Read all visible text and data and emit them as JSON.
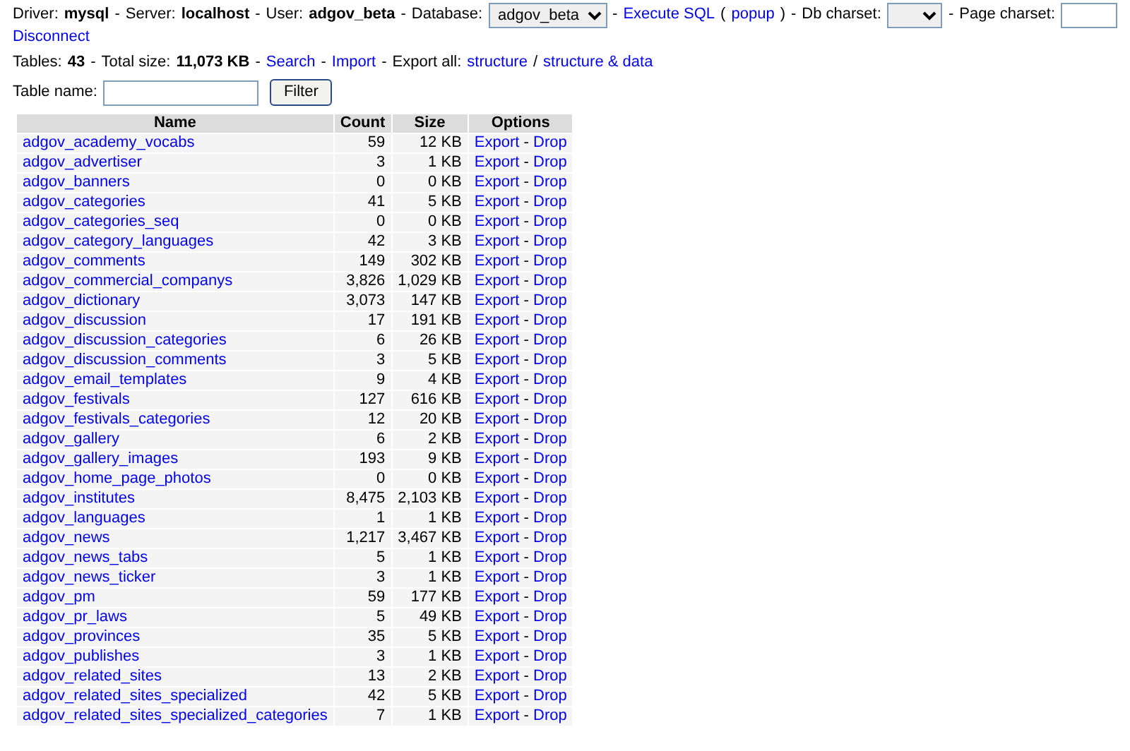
{
  "header": {
    "lines": [
      [
        {
          "kind": "text",
          "text": "Driver:"
        },
        {
          "kind": "bold",
          "text": "mysql"
        },
        {
          "kind": "sep",
          "text": "-"
        },
        {
          "kind": "text",
          "text": "Server:"
        },
        {
          "kind": "bold",
          "text": "localhost"
        },
        {
          "kind": "sep",
          "text": "-"
        },
        {
          "kind": "text",
          "text": "User:"
        },
        {
          "kind": "bold",
          "text": "adgov_beta"
        },
        {
          "kind": "sep",
          "text": "-"
        },
        {
          "kind": "text",
          "text": "Database:"
        },
        {
          "kind": "select",
          "text": "adgov_beta"
        },
        {
          "kind": "sep",
          "text": "-"
        },
        {
          "kind": "link",
          "text": "Execute SQL"
        },
        {
          "kind": "text",
          "text": "("
        },
        {
          "kind": "link",
          "text": "popup"
        },
        {
          "kind": "text",
          "text": ")"
        },
        {
          "kind": "sep",
          "text": "-"
        },
        {
          "kind": "text",
          "text": "Db charset:"
        },
        {
          "kind": "select"
        },
        {
          "kind": "sep",
          "text": "-"
        },
        {
          "kind": "text",
          "text": "Page charset:"
        },
        {
          "kind": "input"
        }
      ],
      [
        {
          "kind": "link",
          "text": "Disconnect"
        }
      ]
    ]
  },
  "stats": [
    {
      "kind": "text",
      "text": "Tables:"
    },
    {
      "kind": "bold",
      "text": "43"
    },
    {
      "kind": "sep",
      "text": "-"
    },
    {
      "kind": "text",
      "text": "Total size:"
    },
    {
      "kind": "bold",
      "text": "11,073 KB"
    },
    {
      "kind": "sep",
      "text": "-"
    },
    {
      "kind": "link",
      "text": "Search"
    },
    {
      "kind": "sep",
      "text": "-"
    },
    {
      "kind": "link",
      "text": "Import"
    },
    {
      "kind": "sep",
      "text": "-"
    },
    {
      "kind": "text",
      "text": "Export all:"
    },
    {
      "kind": "link",
      "text": "structure"
    },
    {
      "kind": "text",
      "text": "/"
    },
    {
      "kind": "link",
      "text": "structure & data"
    }
  ],
  "filter": {
    "label": "Table name:",
    "button": "Filter"
  },
  "table": {
    "columns": [
      "Name",
      "Count",
      "Size",
      "Options"
    ],
    "rows": [
      {
        "name": "adgov_academy_vocabs",
        "count": "59",
        "size": "12 KB",
        "export": "Export",
        "separator": "-",
        "drop": "Drop"
      },
      {
        "name": "adgov_advertiser",
        "count": "3",
        "size": "1 KB",
        "export": "Export",
        "separator": "-",
        "drop": "Drop"
      },
      {
        "name": "adgov_banners",
        "count": "0",
        "size": "0 KB",
        "export": "Export",
        "separator": "-",
        "drop": "Drop"
      },
      {
        "name": "adgov_categories",
        "count": "41",
        "size": "5 KB",
        "export": "Export",
        "separator": "-",
        "drop": "Drop"
      },
      {
        "name": "adgov_categories_seq",
        "count": "0",
        "size": "0 KB",
        "export": "Export",
        "separator": "-",
        "drop": "Drop"
      },
      {
        "name": "adgov_category_languages",
        "count": "42",
        "size": "3 KB",
        "export": "Export",
        "separator": "-",
        "drop": "Drop"
      },
      {
        "name": "adgov_comments",
        "count": "149",
        "size": "302 KB",
        "export": "Export",
        "separator": "-",
        "drop": "Drop"
      },
      {
        "name": "adgov_commercial_companys",
        "count": "3,826",
        "size": "1,029 KB",
        "export": "Export",
        "separator": "-",
        "drop": "Drop"
      },
      {
        "name": "adgov_dictionary",
        "count": "3,073",
        "size": "147 KB",
        "export": "Export",
        "separator": "-",
        "drop": "Drop"
      },
      {
        "name": "adgov_discussion",
        "count": "17",
        "size": "191 KB",
        "export": "Export",
        "separator": "-",
        "drop": "Drop"
      },
      {
        "name": "adgov_discussion_categories",
        "count": "6",
        "size": "26 KB",
        "export": "Export",
        "separator": "-",
        "drop": "Drop"
      },
      {
        "name": "adgov_discussion_comments",
        "count": "3",
        "size": "5 KB",
        "export": "Export",
        "separator": "-",
        "drop": "Drop"
      },
      {
        "name": "adgov_email_templates",
        "count": "9",
        "size": "4 KB",
        "export": "Export",
        "separator": "-",
        "drop": "Drop"
      },
      {
        "name": "adgov_festivals",
        "count": "127",
        "size": "616 KB",
        "export": "Export",
        "separator": "-",
        "drop": "Drop"
      },
      {
        "name": "adgov_festivals_categories",
        "count": "12",
        "size": "20 KB",
        "export": "Export",
        "separator": "-",
        "drop": "Drop"
      },
      {
        "name": "adgov_gallery",
        "count": "6",
        "size": "2 KB",
        "export": "Export",
        "separator": "-",
        "drop": "Drop"
      },
      {
        "name": "adgov_gallery_images",
        "count": "193",
        "size": "9 KB",
        "export": "Export",
        "separator": "-",
        "drop": "Drop"
      },
      {
        "name": "adgov_home_page_photos",
        "count": "0",
        "size": "0 KB",
        "export": "Export",
        "separator": "-",
        "drop": "Drop"
      },
      {
        "name": "adgov_institutes",
        "count": "8,475",
        "size": "2,103 KB",
        "export": "Export",
        "separator": "-",
        "drop": "Drop"
      },
      {
        "name": "adgov_languages",
        "count": "1",
        "size": "1 KB",
        "export": "Export",
        "separator": "-",
        "drop": "Drop"
      },
      {
        "name": "adgov_news",
        "count": "1,217",
        "size": "3,467 KB",
        "export": "Export",
        "separator": "-",
        "drop": "Drop"
      },
      {
        "name": "adgov_news_tabs",
        "count": "5",
        "size": "1 KB",
        "export": "Export",
        "separator": "-",
        "drop": "Drop"
      },
      {
        "name": "adgov_news_ticker",
        "count": "3",
        "size": "1 KB",
        "export": "Export",
        "separator": "-",
        "drop": "Drop"
      },
      {
        "name": "adgov_pm",
        "count": "59",
        "size": "177 KB",
        "export": "Export",
        "separator": "-",
        "drop": "Drop"
      },
      {
        "name": "adgov_pr_laws",
        "count": "5",
        "size": "49 KB",
        "export": "Export",
        "separator": "-",
        "drop": "Drop"
      },
      {
        "name": "adgov_provinces",
        "count": "35",
        "size": "5 KB",
        "export": "Export",
        "separator": "-",
        "drop": "Drop"
      },
      {
        "name": "adgov_publishes",
        "count": "3",
        "size": "1 KB",
        "export": "Export",
        "separator": "-",
        "drop": "Drop"
      },
      {
        "name": "adgov_related_sites",
        "count": "13",
        "size": "2 KB",
        "export": "Export",
        "separator": "-",
        "drop": "Drop"
      },
      {
        "name": "adgov_related_sites_specialized",
        "count": "42",
        "size": "5 KB",
        "export": "Export",
        "separator": "-",
        "drop": "Drop"
      },
      {
        "name": "adgov_related_sites_specialized_categories",
        "count": "7",
        "size": "1 KB",
        "export": "Export",
        "separator": "-",
        "drop": "Drop"
      }
    ]
  }
}
